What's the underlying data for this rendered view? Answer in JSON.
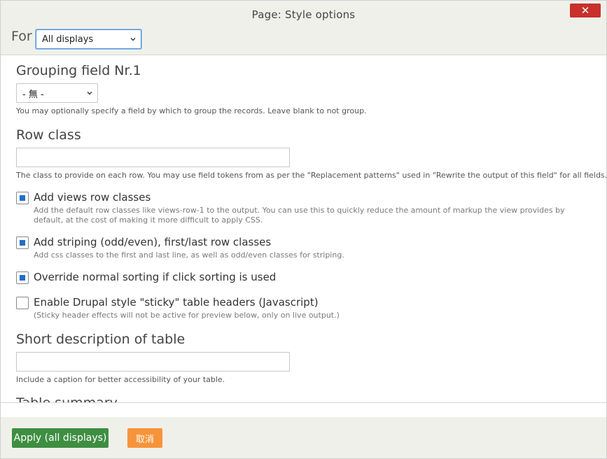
{
  "dialog": {
    "title": "Page: Style options",
    "close_icon": "close-icon"
  },
  "for_selector": {
    "label": "For",
    "selected": "All displays"
  },
  "grouping": {
    "title": "Grouping field Nr.1",
    "selected": "- 無 -",
    "description": "You may optionally specify a field by which to group the records. Leave blank to not group."
  },
  "row_class": {
    "title": "Row class",
    "value": "",
    "description": "The class to provide on each row. You may use field tokens from as per the \"Replacement patterns\" used in \"Rewrite the output of this field\" for all fields."
  },
  "checkboxes": [
    {
      "label": "Add views row classes",
      "checked": true,
      "description": "Add the default row classes like views-row-1 to the output. You can use this to quickly reduce the amount of markup the view provides by default, at the cost of making it more difficult to apply CSS."
    },
    {
      "label": "Add striping (odd/even), first/last row classes",
      "checked": true,
      "description": "Add css classes to the first and last line, as well as odd/even classes for striping."
    },
    {
      "label": "Override normal sorting if click sorting is used",
      "checked": true,
      "description": ""
    },
    {
      "label": "Enable Drupal style \"sticky\" table headers (Javascript)",
      "checked": false,
      "description": "(Sticky header effects will not be active for preview below, only on live output.)"
    }
  ],
  "short_description": {
    "title": "Short description of table",
    "value": "",
    "description": "Include a caption for better accessibility of your table."
  },
  "table_summary": {
    "title": "Table summary"
  },
  "footer": {
    "apply_label": "Apply (all displays)",
    "cancel_label": "取消"
  },
  "colors": {
    "close": "#c9302c",
    "apply": "#3e8e41",
    "cancel": "#f7943a",
    "checkbox_fill": "#1f6fc5",
    "chrome_bg": "#f0f0eb"
  }
}
